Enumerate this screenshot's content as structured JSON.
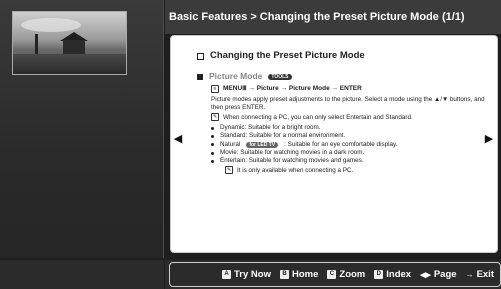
{
  "header": {
    "title": "Basic Features > Changing the Preset Picture Mode (1/1)"
  },
  "content": {
    "heading": "Changing the Preset Picture Mode",
    "section_title": "Picture Mode",
    "section_tag": "TOOLS",
    "menu_path": "MENUⅢ → Picture → Picture Mode → ENTER",
    "description": "Picture modes apply preset adjustments to the picture. Select a mode using the ▲/▼ buttons, and then press ENTER.",
    "note_pc": "When connecting a PC, you can only select Entertain and Standard.",
    "modes": [
      {
        "text": "Dynamic: Suitable for a bright room."
      },
      {
        "text": "Standard: Suitable for a normal environment."
      },
      {
        "pre": "Natural",
        "tag": "for LED TV",
        "text": ": Suitable for an eye comfortable display."
      },
      {
        "text": "Movie: Suitable for watching movies in a dark room."
      },
      {
        "text": "Entertain: Suitable for watching movies and games."
      }
    ],
    "sub_note": "It is only available when connecting a PC."
  },
  "footer": {
    "items": [
      {
        "key": "A",
        "label": "Try Now"
      },
      {
        "key": "B",
        "label": "Home"
      },
      {
        "key": "C",
        "label": "Zoom"
      },
      {
        "key": "D",
        "label": "Index"
      },
      {
        "key": "◀▶",
        "label": "Page"
      },
      {
        "key": "→",
        "label": "Exit"
      }
    ]
  },
  "nav": {
    "left_arrow": "◀",
    "right_arrow": "▶"
  }
}
